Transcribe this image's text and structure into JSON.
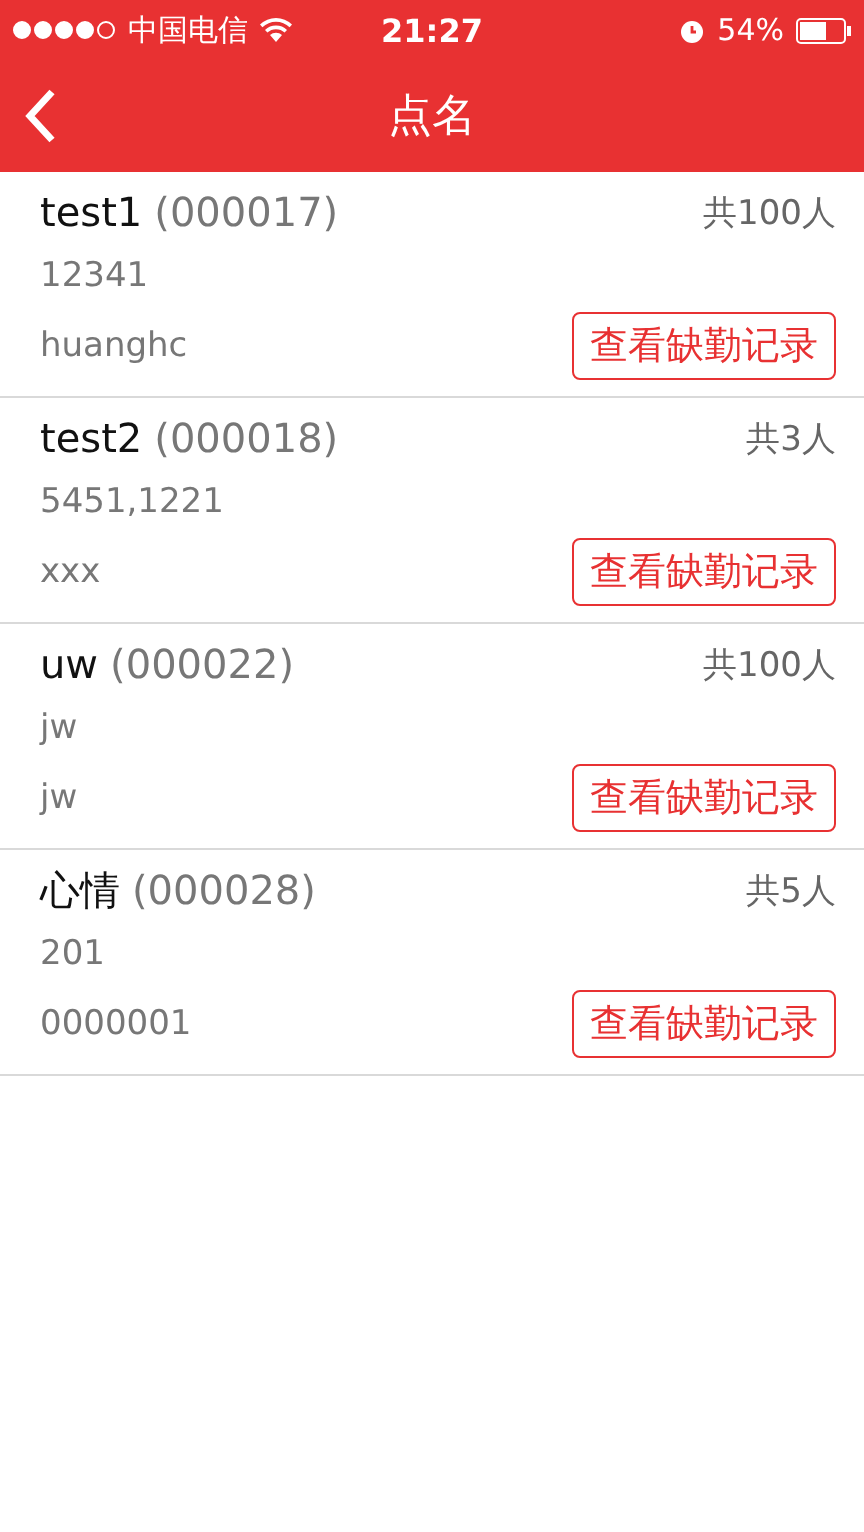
{
  "status_bar": {
    "carrier": "中国电信",
    "time": "21:27",
    "battery": "54%"
  },
  "nav": {
    "title": "点名"
  },
  "items": [
    {
      "name": "test1",
      "code": "(000017)",
      "count": "共100人",
      "line_1": "12341",
      "line_2": "huanghc",
      "action": "查看缺勤记录"
    },
    {
      "name": "test2",
      "code": "(000018)",
      "count": "共3人",
      "line_1": "5451,1221",
      "line_2": "xxx",
      "action": "查看缺勤记录"
    },
    {
      "name": "uw",
      "code": "(000022)",
      "count": "共100人",
      "line_1": "jw",
      "line_2": "jw",
      "action": "查看缺勤记录"
    },
    {
      "name": "心情",
      "code": "(000028)",
      "count": "共5人",
      "line_1": "201",
      "line_2": "0000001",
      "action": "查看缺勤记录"
    }
  ]
}
